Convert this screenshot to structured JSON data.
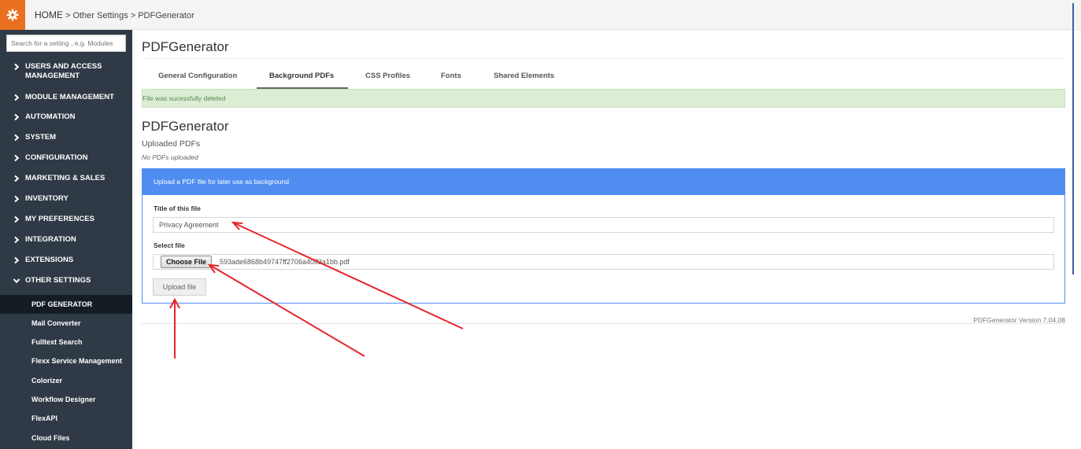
{
  "breadcrumb": {
    "home": "HOME",
    "sep": ">",
    "level1": "Other Settings",
    "level2": "PDFGenerator"
  },
  "sidebar": {
    "search_placeholder": "Search for a setting , e.g. Modules",
    "items": [
      {
        "label": "USERS AND ACCESS MANAGEMENT",
        "expanded": false
      },
      {
        "label": "MODULE MANAGEMENT",
        "expanded": false
      },
      {
        "label": "AUTOMATION",
        "expanded": false
      },
      {
        "label": "SYSTEM",
        "expanded": false
      },
      {
        "label": "CONFIGURATION",
        "expanded": false
      },
      {
        "label": "MARKETING & SALES",
        "expanded": false
      },
      {
        "label": "INVENTORY",
        "expanded": false
      },
      {
        "label": "MY PREFERENCES",
        "expanded": false
      },
      {
        "label": "INTEGRATION",
        "expanded": false
      },
      {
        "label": "EXTENSIONS",
        "expanded": false
      },
      {
        "label": "OTHER SETTINGS",
        "expanded": true
      }
    ],
    "sub_items": [
      {
        "label": "PDF GENERATOR",
        "active": true
      },
      {
        "label": "Mail Converter",
        "active": false
      },
      {
        "label": "Fulltext Search",
        "active": false
      },
      {
        "label": "Flexx Service Management",
        "active": false
      },
      {
        "label": "Colorizer",
        "active": false
      },
      {
        "label": "Workflow Designer",
        "active": false
      },
      {
        "label": "FlexAPI",
        "active": false
      },
      {
        "label": "Cloud Files",
        "active": false
      }
    ]
  },
  "main": {
    "title": "PDFGenerator",
    "tabs": [
      {
        "label": "General Configuration",
        "active": false
      },
      {
        "label": "Background PDFs",
        "active": true
      },
      {
        "label": "CSS Profiles",
        "active": false
      },
      {
        "label": "Fonts",
        "active": false
      },
      {
        "label": "Shared Elements",
        "active": false
      }
    ],
    "alert": "File was sucessfully deleted",
    "section_title": "PDFGenerator",
    "uploaded_label": "Uploaded PDFs",
    "no_pdfs": "No PDFs uploaded",
    "panel": {
      "heading": "Upload a PDF file for later use as background",
      "title_label": "Title of this file",
      "title_value": "Privacy Agreement",
      "file_label": "Select file",
      "choose_label": "Choose File",
      "file_name": "593ade6868b49747ff2706a40ff3a1bb.pdf",
      "upload_label": "Upload file"
    },
    "version": "PDFGenerator Version 7.04.08"
  },
  "colors": {
    "accent_orange": "#e8701f",
    "sidebar_bg": "#2f3a46",
    "panel_blue": "#4f8ef0",
    "alert_green": "#dcedd4",
    "annotation_red": "#e8242a"
  }
}
